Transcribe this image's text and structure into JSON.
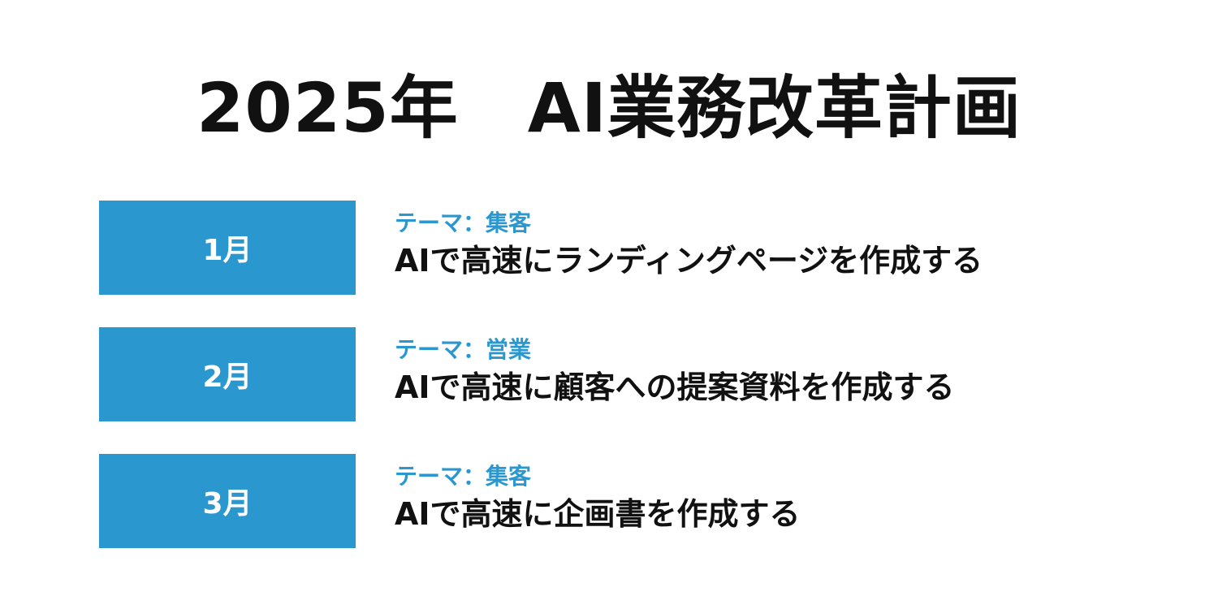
{
  "title": "2025年　AI業務改革計画",
  "plans": [
    {
      "month": "1月",
      "theme": "テーマ：集客",
      "task": "AIで高速にランディングページを作成する"
    },
    {
      "month": "2月",
      "theme": "テーマ：営業",
      "task": "AIで高速に顧客への提案資料を作成する"
    },
    {
      "month": "3月",
      "theme": "テーマ：集客",
      "task": "AIで高速に企画書を作成する"
    }
  ],
  "colors": {
    "accent": "#2a98cf",
    "text": "#111111",
    "background": "#ffffff"
  }
}
